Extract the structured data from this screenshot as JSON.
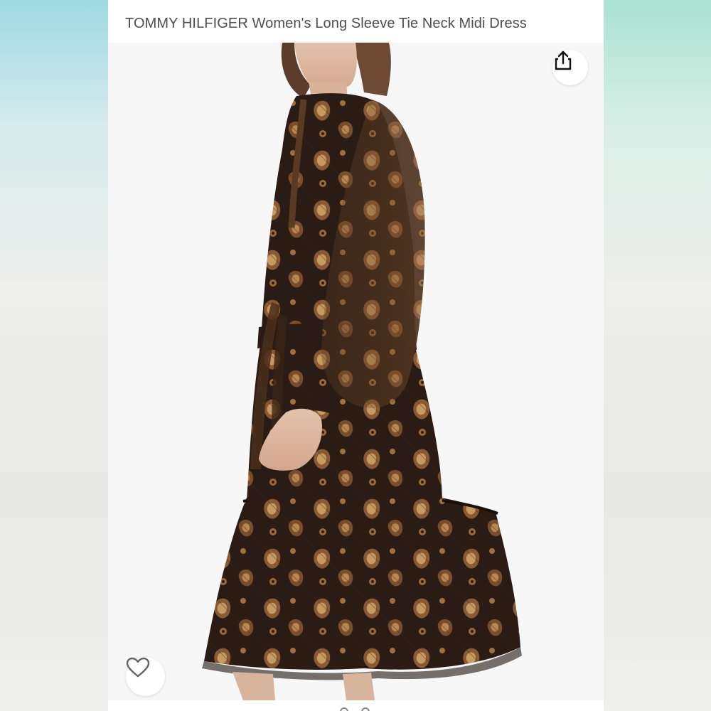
{
  "product": {
    "title": "TOMMY HILFIGER Women's Long Sleeve Tie Neck Midi Dress"
  },
  "icons": {
    "share": "share-icon",
    "wishlist": "heart-icon"
  },
  "colors": {
    "background_teal": "#a8dde6",
    "card": "#ffffff",
    "title_text": "#4a4f57",
    "dress_dark": "#2a1c14",
    "dress_brown": "#8a5a34",
    "paisley_tan": "#c79a62"
  },
  "carousel": {
    "current": 1,
    "total": 2
  }
}
